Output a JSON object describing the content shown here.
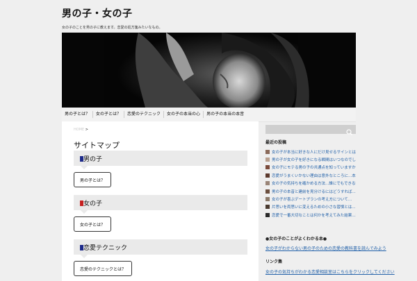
{
  "site": {
    "title": "男の子・女の子",
    "description": "女の子のことを男の子に教えます。恋愛の処方箋みたいなもの。"
  },
  "nav": {
    "items": [
      "男の子とは？",
      "女の子とは？",
      "恋愛のテクニック",
      "女の子の本当の心",
      "男の子の本当の本音"
    ]
  },
  "breadcrumb": {
    "home": "HOME",
    "separator": ">"
  },
  "main": {
    "page_title": "サイトマップ",
    "sections": [
      {
        "mark_color": "#1d2a8a",
        "heading": "男の子",
        "button": "男の子とは？"
      },
      {
        "mark_color": "#c62020",
        "heading": "女の子",
        "button": "女の子とは？"
      },
      {
        "mark_color": "#1d2a8a",
        "heading": "恋愛テクニック",
        "button": "恋愛のテクニックとは？"
      }
    ]
  },
  "sidebar": {
    "search_placeholder": "",
    "recent_title": "最近の投稿",
    "posts": [
      {
        "thumb_color": "#8a6a5a",
        "title": "女の子が本当に好きな人にだけ見せるサインとは..."
      },
      {
        "thumb_color": "#b9a08f",
        "title": "男の子が女の子を好きになる瞬間はいつなのでしょうか..."
      },
      {
        "thumb_color": "#7a4a3a",
        "title": "女の子にモテる男の子の共通点を知っていますか..."
      },
      {
        "thumb_color": "#5c3a2e",
        "title": "恋愛がうまくいかない理由は意外なところに...本当の原因"
      },
      {
        "thumb_color": "#9a8578",
        "title": "女の子の気持ちを確かめる方法...誰にでもできる簡単なこと"
      },
      {
        "thumb_color": "#6b4f3f",
        "title": "男の子の本音と建前を見分けるにはどうすれば..."
      },
      {
        "thumb_color": "#8c7a6a",
        "title": "女の子が喜ぶデートプランの考え方について..."
      },
      {
        "thumb_color": "#4a3a30",
        "title": "片思いを両思いに変えるための小さな習慣とは..."
      },
      {
        "thumb_color": "#2a2a2a",
        "title": "恋愛で一番大切なことは何かを考えてみた結果...本当"
      }
    ],
    "featured_title": "●女の子のことがよくわかる本●",
    "featured_link": "女の子がわからない男の子のための恋愛の教科書を読んでみよう",
    "links_title": "リンク集",
    "links_link": "女の子の気持ちがわかる恋愛相談室はこちらをクリックしてください"
  }
}
